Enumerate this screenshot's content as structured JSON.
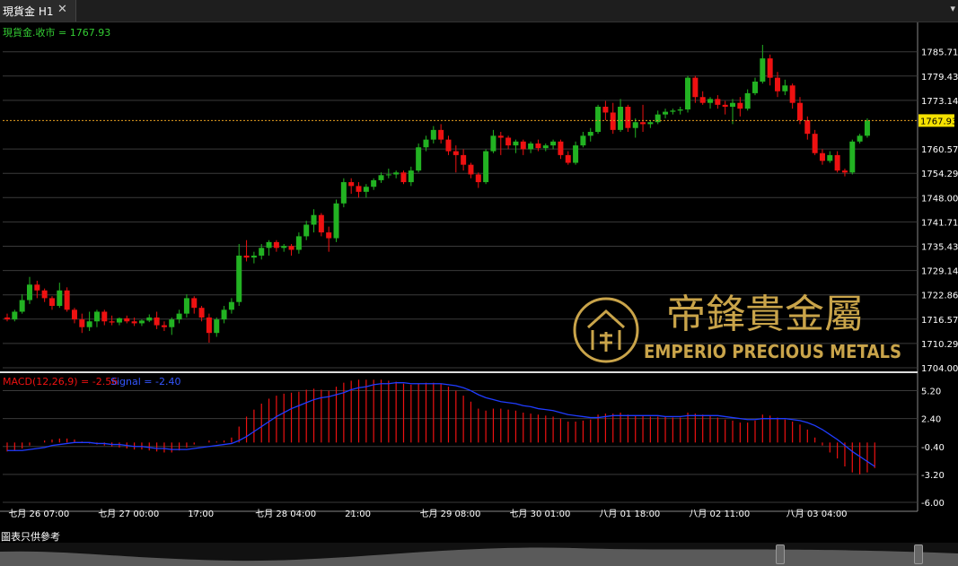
{
  "tab": {
    "title": "現貨金 H1",
    "close": "✕"
  },
  "menu_icon": "▾",
  "footnote": "圖表只供參考",
  "watermark": {
    "brand_cn": "帝鋒貴金屬",
    "brand_en": "EMPERIO PRECIOUS METALS"
  },
  "colors": {
    "bull": "#22b222",
    "bear": "#ee1111",
    "macd": "#ee1111",
    "signal": "#1f3cff",
    "current_price_line": "#e8a020",
    "price_label_bg": "#f5e100",
    "grid": "#3a3a3a",
    "text_green": "#33cc33",
    "axis_text": "#ffffff"
  },
  "chart_data": [
    {
      "type": "candlestick",
      "title": "現貨金.收市 = 1767.93",
      "instrument": "現貨金",
      "timeframe": "H1",
      "last_price": 1767.93,
      "last_price_label": "1767.93",
      "y_ticks": [
        "1785.71",
        "1779.43",
        "1773.14",
        "1767.93",
        "1760.57",
        "1754.29",
        "1748.00",
        "1741.71",
        "1735.43",
        "1729.14",
        "1722.86",
        "1716.57",
        "1710.29",
        "1704.00"
      ],
      "ylim": [
        1704.0,
        1788.2
      ],
      "x_labels": [
        "七月 26 07:00",
        "七月 27 00:00",
        "17:00",
        "七月 28 04:00",
        "21:00",
        "七月 29 08:00",
        "七月 30 01:00",
        "八月 01 18:00",
        "八月 02 11:00",
        "八月 03 04:00"
      ],
      "x_label_bar_index": [
        1,
        13,
        25,
        34,
        46,
        56,
        68,
        80,
        92,
        105
      ],
      "candles": [
        [
          1717.0,
          1718.0,
          1716.0,
          1716.5
        ],
        [
          1716.5,
          1719.0,
          1716.0,
          1718.5
        ],
        [
          1718.5,
          1723.0,
          1718.0,
          1721.5
        ],
        [
          1721.5,
          1727.5,
          1720.5,
          1725.5
        ],
        [
          1725.5,
          1726.5,
          1722.0,
          1724.0
        ],
        [
          1724.0,
          1724.5,
          1721.0,
          1722.0
        ],
        [
          1722.0,
          1722.5,
          1719.0,
          1720.0
        ],
        [
          1720.0,
          1726.0,
          1719.5,
          1724.0
        ],
        [
          1724.0,
          1724.8,
          1718.5,
          1719.0
        ],
        [
          1719.0,
          1719.5,
          1715.5,
          1716.5
        ],
        [
          1716.5,
          1718.0,
          1713.0,
          1714.5
        ],
        [
          1714.5,
          1718.5,
          1713.5,
          1716.0
        ],
        [
          1716.0,
          1719.0,
          1714.5,
          1718.5
        ],
        [
          1718.5,
          1719.0,
          1715.0,
          1716.0
        ],
        [
          1716.0,
          1717.5,
          1715.0,
          1715.7
        ],
        [
          1715.7,
          1717.0,
          1715.0,
          1716.8
        ],
        [
          1716.8,
          1717.5,
          1715.5,
          1716.0
        ],
        [
          1716.0,
          1717.0,
          1714.8,
          1715.5
        ],
        [
          1715.5,
          1716.5,
          1714.8,
          1716.2
        ],
        [
          1716.2,
          1717.8,
          1715.8,
          1717.0
        ],
        [
          1717.0,
          1718.5,
          1714.0,
          1715.0
        ],
        [
          1715.0,
          1716.0,
          1713.5,
          1714.5
        ],
        [
          1714.5,
          1717.0,
          1712.5,
          1716.5
        ],
        [
          1716.5,
          1719.0,
          1715.5,
          1718.0
        ],
        [
          1718.0,
          1723.0,
          1717.0,
          1722.0
        ],
        [
          1722.0,
          1722.5,
          1718.0,
          1719.5
        ],
        [
          1719.5,
          1720.0,
          1716.0,
          1717.0
        ],
        [
          1717.0,
          1718.0,
          1710.5,
          1713.0
        ],
        [
          1713.0,
          1717.0,
          1712.0,
          1716.5
        ],
        [
          1716.5,
          1720.0,
          1715.5,
          1719.0
        ],
        [
          1719.0,
          1722.0,
          1718.0,
          1721.0
        ],
        [
          1721.0,
          1736.0,
          1720.0,
          1733.0
        ],
        [
          1733.0,
          1737.0,
          1731.5,
          1732.5
        ],
        [
          1732.5,
          1734.0,
          1731.0,
          1733.0
        ],
        [
          1733.0,
          1736.0,
          1732.0,
          1735.0
        ],
        [
          1735.0,
          1737.0,
          1733.0,
          1736.5
        ],
        [
          1736.5,
          1737.0,
          1734.0,
          1735.0
        ],
        [
          1735.0,
          1736.0,
          1734.0,
          1735.5
        ],
        [
          1735.5,
          1736.0,
          1733.0,
          1734.5
        ],
        [
          1734.5,
          1739.0,
          1733.5,
          1738.0
        ],
        [
          1738.0,
          1742.0,
          1737.0,
          1741.0
        ],
        [
          1741.0,
          1745.0,
          1739.0,
          1743.5
        ],
        [
          1743.5,
          1744.0,
          1738.0,
          1739.0
        ],
        [
          1739.0,
          1740.5,
          1734.0,
          1737.5
        ],
        [
          1737.5,
          1747.5,
          1736.5,
          1746.5
        ],
        [
          1746.5,
          1753.0,
          1745.5,
          1752.0
        ],
        [
          1752.0,
          1753.0,
          1749.0,
          1751.0
        ],
        [
          1751.0,
          1752.0,
          1748.0,
          1749.5
        ],
        [
          1749.5,
          1751.5,
          1748.0,
          1750.8
        ],
        [
          1750.8,
          1753.0,
          1750.0,
          1752.5
        ],
        [
          1752.5,
          1754.5,
          1751.8,
          1753.8
        ],
        [
          1753.8,
          1755.5,
          1753.0,
          1754.0
        ],
        [
          1754.0,
          1755.0,
          1753.0,
          1754.5
        ],
        [
          1754.5,
          1755.0,
          1751.5,
          1752.0
        ],
        [
          1752.0,
          1756.0,
          1751.0,
          1755.0
        ],
        [
          1755.0,
          1762.0,
          1754.5,
          1761.0
        ],
        [
          1761.0,
          1764.0,
          1760.0,
          1763.0
        ],
        [
          1763.0,
          1766.5,
          1762.0,
          1765.5
        ],
        [
          1765.5,
          1767.0,
          1762.0,
          1763.0
        ],
        [
          1763.0,
          1764.0,
          1759.0,
          1760.0
        ],
        [
          1760.0,
          1761.5,
          1754.5,
          1759.0
        ],
        [
          1759.0,
          1760.5,
          1755.0,
          1756.5
        ],
        [
          1756.5,
          1757.0,
          1753.0,
          1754.0
        ],
        [
          1754.0,
          1754.5,
          1750.5,
          1752.0
        ],
        [
          1752.0,
          1760.5,
          1751.5,
          1760.0
        ],
        [
          1760.0,
          1765.5,
          1759.5,
          1764.0
        ],
        [
          1764.0,
          1765.0,
          1759.0,
          1763.5
        ],
        [
          1763.5,
          1764.0,
          1760.5,
          1761.5
        ],
        [
          1761.5,
          1763.0,
          1759.5,
          1762.5
        ],
        [
          1762.5,
          1763.0,
          1759.0,
          1760.5
        ],
        [
          1760.5,
          1762.5,
          1759.5,
          1762.0
        ],
        [
          1762.0,
          1763.0,
          1760.0,
          1760.8
        ],
        [
          1760.8,
          1762.0,
          1760.0,
          1761.5
        ],
        [
          1761.5,
          1763.0,
          1760.5,
          1762.5
        ],
        [
          1762.5,
          1763.0,
          1758.0,
          1759.0
        ],
        [
          1759.0,
          1760.0,
          1756.5,
          1757.0
        ],
        [
          1757.0,
          1762.5,
          1756.5,
          1761.5
        ],
        [
          1761.5,
          1765.0,
          1761.0,
          1764.0
        ],
        [
          1764.0,
          1766.0,
          1762.5,
          1765.0
        ],
        [
          1765.0,
          1772.0,
          1764.5,
          1771.5
        ],
        [
          1771.5,
          1773.0,
          1768.0,
          1770.0
        ],
        [
          1770.0,
          1772.5,
          1764.5,
          1765.5
        ],
        [
          1765.5,
          1773.5,
          1765.0,
          1771.5
        ],
        [
          1771.5,
          1772.0,
          1765.0,
          1766.0
        ],
        [
          1766.0,
          1768.5,
          1763.5,
          1767.5
        ],
        [
          1767.5,
          1772.0,
          1765.0,
          1767.0
        ],
        [
          1767.0,
          1768.0,
          1766.0,
          1767.5
        ],
        [
          1767.5,
          1770.5,
          1767.0,
          1769.5
        ],
        [
          1769.5,
          1771.0,
          1768.5,
          1770.2
        ],
        [
          1770.2,
          1771.0,
          1769.5,
          1770.5
        ],
        [
          1770.5,
          1771.5,
          1769.5,
          1770.8
        ],
        [
          1770.8,
          1779.5,
          1770.0,
          1779.0
        ],
        [
          1779.0,
          1779.5,
          1772.5,
          1774.0
        ],
        [
          1774.0,
          1775.5,
          1772.0,
          1772.5
        ],
        [
          1772.5,
          1774.0,
          1771.0,
          1773.5
        ],
        [
          1773.5,
          1774.5,
          1771.0,
          1772.0
        ],
        [
          1772.0,
          1773.0,
          1769.5,
          1771.5
        ],
        [
          1771.5,
          1773.5,
          1767.0,
          1772.5
        ],
        [
          1772.5,
          1774.0,
          1769.0,
          1771.0
        ],
        [
          1771.0,
          1776.0,
          1770.5,
          1775.0
        ],
        [
          1775.0,
          1779.0,
          1774.5,
          1778.0
        ],
        [
          1778.0,
          1787.5,
          1777.5,
          1784.0
        ],
        [
          1784.0,
          1785.0,
          1777.0,
          1779.0
        ],
        [
          1779.0,
          1780.5,
          1774.0,
          1775.5
        ],
        [
          1775.5,
          1778.5,
          1774.5,
          1777.0
        ],
        [
          1777.0,
          1777.5,
          1771.0,
          1772.5
        ],
        [
          1772.5,
          1774.0,
          1767.0,
          1768.0
        ],
        [
          1768.0,
          1769.0,
          1763.0,
          1764.5
        ],
        [
          1764.5,
          1765.5,
          1759.0,
          1759.5
        ],
        [
          1759.5,
          1760.5,
          1756.5,
          1757.5
        ],
        [
          1757.5,
          1760.0,
          1757.0,
          1759.0
        ],
        [
          1759.0,
          1760.0,
          1754.5,
          1755.0
        ],
        [
          1755.0,
          1755.5,
          1753.5,
          1754.5
        ],
        [
          1754.5,
          1763.0,
          1754.0,
          1762.5
        ],
        [
          1762.5,
          1764.5,
          1762.0,
          1764.0
        ],
        [
          1764.0,
          1768.5,
          1763.5,
          1767.93
        ]
      ]
    },
    {
      "type": "bar+line",
      "title": "MACD(12,26,9) = -2.56",
      "signal_title": "Signal = -2.40",
      "y_ticks": [
        "5.20",
        "2.40",
        "-0.40",
        "-3.20",
        "-6.00"
      ],
      "ylim": [
        -6.0,
        6.6
      ],
      "macd": [
        -0.9,
        -0.8,
        -0.6,
        -0.3,
        0.0,
        0.2,
        0.3,
        0.4,
        0.4,
        0.3,
        0.1,
        -0.1,
        -0.2,
        -0.3,
        -0.4,
        -0.5,
        -0.6,
        -0.7,
        -0.7,
        -0.8,
        -0.9,
        -1.0,
        -1.0,
        -0.8,
        -0.5,
        -0.2,
        0.0,
        0.2,
        0.1,
        0.2,
        0.5,
        1.6,
        2.6,
        3.3,
        3.9,
        4.4,
        4.7,
        4.9,
        5.0,
        5.1,
        5.3,
        5.4,
        5.3,
        5.2,
        5.6,
        6.0,
        6.2,
        6.3,
        6.3,
        6.3,
        6.3,
        6.2,
        6.1,
        5.9,
        5.8,
        5.9,
        6.0,
        6.0,
        5.9,
        5.6,
        5.2,
        4.7,
        4.1,
        3.4,
        3.2,
        3.4,
        3.4,
        3.3,
        3.2,
        3.0,
        2.9,
        2.8,
        2.7,
        2.6,
        2.4,
        2.1,
        2.1,
        2.2,
        2.3,
        2.8,
        2.9,
        2.9,
        3.0,
        2.8,
        2.7,
        2.7,
        2.6,
        2.6,
        2.6,
        2.5,
        2.5,
        3.0,
        2.9,
        2.8,
        2.7,
        2.5,
        2.3,
        2.2,
        2.0,
        2.0,
        2.2,
        2.8,
        2.7,
        2.5,
        2.3,
        2.1,
        1.8,
        1.3,
        0.5,
        -0.3,
        -1.0,
        -1.6,
        -2.4,
        -3.0,
        -3.2,
        -3.0,
        -2.56
      ],
      "signal": [
        -0.8,
        -0.8,
        -0.8,
        -0.7,
        -0.6,
        -0.5,
        -0.3,
        -0.2,
        -0.1,
        0.0,
        0.0,
        0.0,
        -0.1,
        -0.1,
        -0.2,
        -0.2,
        -0.3,
        -0.4,
        -0.4,
        -0.5,
        -0.6,
        -0.6,
        -0.7,
        -0.7,
        -0.7,
        -0.6,
        -0.5,
        -0.4,
        -0.3,
        -0.2,
        -0.1,
        0.2,
        0.6,
        1.1,
        1.6,
        2.1,
        2.6,
        3.0,
        3.4,
        3.7,
        4.0,
        4.3,
        4.5,
        4.6,
        4.8,
        5.0,
        5.3,
        5.5,
        5.6,
        5.8,
        5.9,
        5.9,
        6.0,
        6.0,
        5.9,
        5.9,
        5.9,
        5.9,
        5.9,
        5.8,
        5.7,
        5.5,
        5.2,
        4.8,
        4.5,
        4.3,
        4.1,
        4.0,
        3.9,
        3.7,
        3.6,
        3.4,
        3.3,
        3.2,
        3.0,
        2.8,
        2.7,
        2.6,
        2.5,
        2.5,
        2.6,
        2.7,
        2.7,
        2.7,
        2.7,
        2.7,
        2.7,
        2.7,
        2.6,
        2.6,
        2.6,
        2.7,
        2.7,
        2.7,
        2.7,
        2.7,
        2.6,
        2.5,
        2.4,
        2.3,
        2.3,
        2.4,
        2.4,
        2.4,
        2.4,
        2.3,
        2.2,
        2.0,
        1.7,
        1.3,
        0.8,
        0.3,
        -0.3,
        -0.9,
        -1.4,
        -1.9,
        -2.4
      ]
    }
  ]
}
